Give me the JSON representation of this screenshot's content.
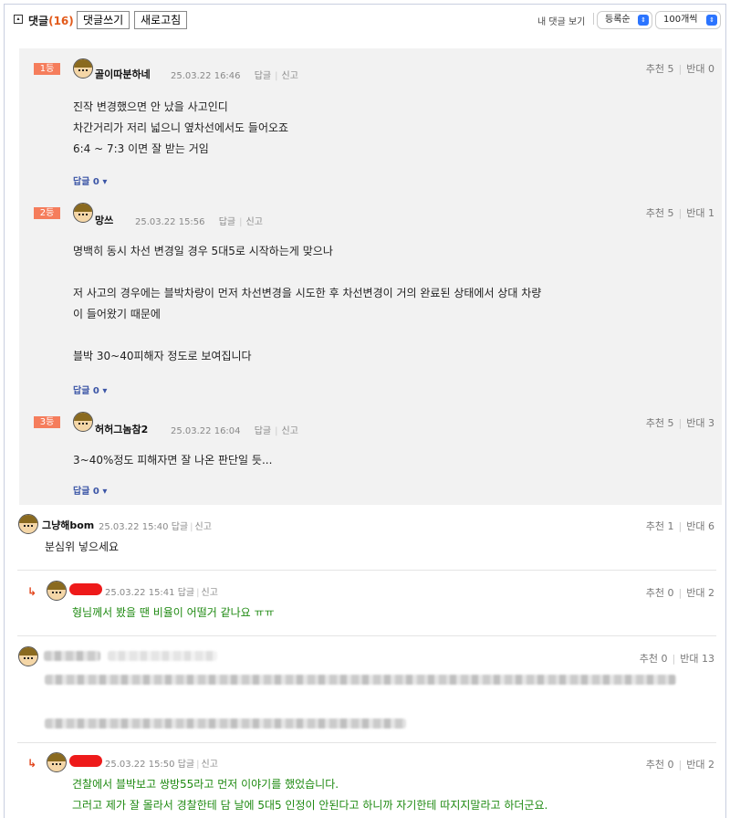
{
  "header": {
    "title": "댓글",
    "count": "(16)",
    "write_button": "댓글쓰기",
    "refresh_button": "새로고침",
    "my_comments": "내 댓글 보기",
    "sort_select": "등록순",
    "page_size_select": "100개씩"
  },
  "best_comments": [
    {
      "rank": "1등",
      "nick": "골이따분하네",
      "date": "25.03.22 16:46",
      "reply": "답글",
      "report": "신고",
      "up": "추천 5",
      "down": "반대 0",
      "body": "진작 변경했으면 안 났을 사고인디\n차간거리가 저리 넓으니 옆차선에서도 들어오죠\n6:4 ~ 7:3 이면 잘 받는 거임",
      "reply_count": "답글 0"
    },
    {
      "rank": "2등",
      "nick": "망쓰",
      "date": "25.03.22 15:56",
      "reply": "답글",
      "report": "신고",
      "up": "추천 5",
      "down": "반대 1",
      "body": "명백히 동시 차선 변경일 경우 5대5로 시작하는게 맞으나\n\n저 사고의 경우에는 블박차량이 먼저 차선변경을 시도한 후 차선변경이 거의 완료된 상태에서 상대 차량\n이 들어왔기 때문에\n\n블박 30~40피해자 정도로 보여집니다",
      "reply_count": "답글 0"
    },
    {
      "rank": "3등",
      "nick": "허허그놈참2",
      "date": "25.03.22 16:04",
      "reply": "답글",
      "report": "신고",
      "up": "추천 5",
      "down": "반대 3",
      "body": "3~40%정도 피해자면 잘 나온 판단일 듯...",
      "reply_count": "답글 0"
    }
  ],
  "comments": [
    {
      "nick": "그냥해bom",
      "date": "25.03.22 15:40",
      "reply": "답글",
      "report": "신고",
      "up": "추천 1",
      "down": "반대 6",
      "body": "분심위 넣으세요"
    },
    {
      "date": "25.03.22 15:41",
      "reply": "답글",
      "report": "신고",
      "up": "추천 0",
      "down": "반대 2",
      "body": "형님께서 봤을 땐 비율이 어떨거 같나요 ㅠㅠ"
    },
    {
      "up": "추천 0",
      "down": "반대 13"
    },
    {
      "date": "25.03.22 15:50",
      "reply": "답글",
      "report": "신고",
      "up": "추천 0",
      "down": "반대 2",
      "body": "견찰에서 블박보고 쌍방55라고 먼저 이야기를 했었습니다.\n그러고 제가 잘 몰라서 경찰한테 담 날에 5대5 인정이 안된다고 하니까 자기한테 따지지말라고 하더군요."
    }
  ],
  "colors": {
    "accent": "#e25a1a",
    "rank": "#f57d5c",
    "reply_link": "#3b55a6",
    "reply_text": "#1f8a12"
  }
}
